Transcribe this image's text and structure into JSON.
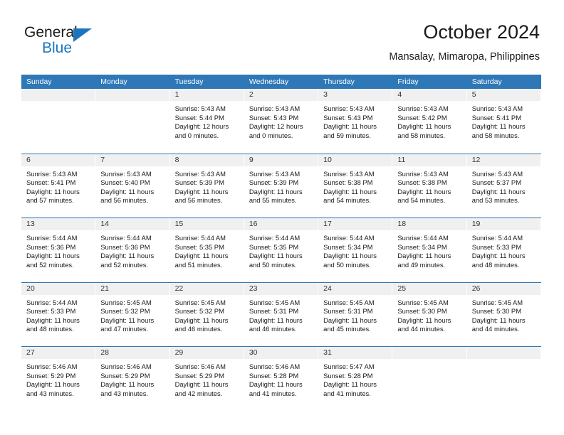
{
  "brand": {
    "name_part1": "General",
    "name_part2": "Blue",
    "accent_color": "#1d76bd"
  },
  "header": {
    "title": "October 2024",
    "location": "Mansalay, Mimaropa, Philippines"
  },
  "theme": {
    "header_blue": "#2e78b8",
    "day_header_gray": "#f0f0f0",
    "text_color": "#1a1a1a"
  },
  "weekdays": [
    "Sunday",
    "Monday",
    "Tuesday",
    "Wednesday",
    "Thursday",
    "Friday",
    "Saturday"
  ],
  "weeks": [
    [
      {
        "day": "",
        "lines": []
      },
      {
        "day": "",
        "lines": []
      },
      {
        "day": "1",
        "lines": [
          "Sunrise: 5:43 AM",
          "Sunset: 5:44 PM",
          "Daylight: 12 hours",
          "and 0 minutes."
        ]
      },
      {
        "day": "2",
        "lines": [
          "Sunrise: 5:43 AM",
          "Sunset: 5:43 PM",
          "Daylight: 12 hours",
          "and 0 minutes."
        ]
      },
      {
        "day": "3",
        "lines": [
          "Sunrise: 5:43 AM",
          "Sunset: 5:43 PM",
          "Daylight: 11 hours",
          "and 59 minutes."
        ]
      },
      {
        "day": "4",
        "lines": [
          "Sunrise: 5:43 AM",
          "Sunset: 5:42 PM",
          "Daylight: 11 hours",
          "and 58 minutes."
        ]
      },
      {
        "day": "5",
        "lines": [
          "Sunrise: 5:43 AM",
          "Sunset: 5:41 PM",
          "Daylight: 11 hours",
          "and 58 minutes."
        ]
      }
    ],
    [
      {
        "day": "6",
        "lines": [
          "Sunrise: 5:43 AM",
          "Sunset: 5:41 PM",
          "Daylight: 11 hours",
          "and 57 minutes."
        ]
      },
      {
        "day": "7",
        "lines": [
          "Sunrise: 5:43 AM",
          "Sunset: 5:40 PM",
          "Daylight: 11 hours",
          "and 56 minutes."
        ]
      },
      {
        "day": "8",
        "lines": [
          "Sunrise: 5:43 AM",
          "Sunset: 5:39 PM",
          "Daylight: 11 hours",
          "and 56 minutes."
        ]
      },
      {
        "day": "9",
        "lines": [
          "Sunrise: 5:43 AM",
          "Sunset: 5:39 PM",
          "Daylight: 11 hours",
          "and 55 minutes."
        ]
      },
      {
        "day": "10",
        "lines": [
          "Sunrise: 5:43 AM",
          "Sunset: 5:38 PM",
          "Daylight: 11 hours",
          "and 54 minutes."
        ]
      },
      {
        "day": "11",
        "lines": [
          "Sunrise: 5:43 AM",
          "Sunset: 5:38 PM",
          "Daylight: 11 hours",
          "and 54 minutes."
        ]
      },
      {
        "day": "12",
        "lines": [
          "Sunrise: 5:43 AM",
          "Sunset: 5:37 PM",
          "Daylight: 11 hours",
          "and 53 minutes."
        ]
      }
    ],
    [
      {
        "day": "13",
        "lines": [
          "Sunrise: 5:44 AM",
          "Sunset: 5:36 PM",
          "Daylight: 11 hours",
          "and 52 minutes."
        ]
      },
      {
        "day": "14",
        "lines": [
          "Sunrise: 5:44 AM",
          "Sunset: 5:36 PM",
          "Daylight: 11 hours",
          "and 52 minutes."
        ]
      },
      {
        "day": "15",
        "lines": [
          "Sunrise: 5:44 AM",
          "Sunset: 5:35 PM",
          "Daylight: 11 hours",
          "and 51 minutes."
        ]
      },
      {
        "day": "16",
        "lines": [
          "Sunrise: 5:44 AM",
          "Sunset: 5:35 PM",
          "Daylight: 11 hours",
          "and 50 minutes."
        ]
      },
      {
        "day": "17",
        "lines": [
          "Sunrise: 5:44 AM",
          "Sunset: 5:34 PM",
          "Daylight: 11 hours",
          "and 50 minutes."
        ]
      },
      {
        "day": "18",
        "lines": [
          "Sunrise: 5:44 AM",
          "Sunset: 5:34 PM",
          "Daylight: 11 hours",
          "and 49 minutes."
        ]
      },
      {
        "day": "19",
        "lines": [
          "Sunrise: 5:44 AM",
          "Sunset: 5:33 PM",
          "Daylight: 11 hours",
          "and 48 minutes."
        ]
      }
    ],
    [
      {
        "day": "20",
        "lines": [
          "Sunrise: 5:44 AM",
          "Sunset: 5:33 PM",
          "Daylight: 11 hours",
          "and 48 minutes."
        ]
      },
      {
        "day": "21",
        "lines": [
          "Sunrise: 5:45 AM",
          "Sunset: 5:32 PM",
          "Daylight: 11 hours",
          "and 47 minutes."
        ]
      },
      {
        "day": "22",
        "lines": [
          "Sunrise: 5:45 AM",
          "Sunset: 5:32 PM",
          "Daylight: 11 hours",
          "and 46 minutes."
        ]
      },
      {
        "day": "23",
        "lines": [
          "Sunrise: 5:45 AM",
          "Sunset: 5:31 PM",
          "Daylight: 11 hours",
          "and 46 minutes."
        ]
      },
      {
        "day": "24",
        "lines": [
          "Sunrise: 5:45 AM",
          "Sunset: 5:31 PM",
          "Daylight: 11 hours",
          "and 45 minutes."
        ]
      },
      {
        "day": "25",
        "lines": [
          "Sunrise: 5:45 AM",
          "Sunset: 5:30 PM",
          "Daylight: 11 hours",
          "and 44 minutes."
        ]
      },
      {
        "day": "26",
        "lines": [
          "Sunrise: 5:45 AM",
          "Sunset: 5:30 PM",
          "Daylight: 11 hours",
          "and 44 minutes."
        ]
      }
    ],
    [
      {
        "day": "27",
        "lines": [
          "Sunrise: 5:46 AM",
          "Sunset: 5:29 PM",
          "Daylight: 11 hours",
          "and 43 minutes."
        ]
      },
      {
        "day": "28",
        "lines": [
          "Sunrise: 5:46 AM",
          "Sunset: 5:29 PM",
          "Daylight: 11 hours",
          "and 43 minutes."
        ]
      },
      {
        "day": "29",
        "lines": [
          "Sunrise: 5:46 AM",
          "Sunset: 5:29 PM",
          "Daylight: 11 hours",
          "and 42 minutes."
        ]
      },
      {
        "day": "30",
        "lines": [
          "Sunrise: 5:46 AM",
          "Sunset: 5:28 PM",
          "Daylight: 11 hours",
          "and 41 minutes."
        ]
      },
      {
        "day": "31",
        "lines": [
          "Sunrise: 5:47 AM",
          "Sunset: 5:28 PM",
          "Daylight: 11 hours",
          "and 41 minutes."
        ]
      },
      {
        "day": "",
        "lines": []
      },
      {
        "day": "",
        "lines": []
      }
    ]
  ]
}
